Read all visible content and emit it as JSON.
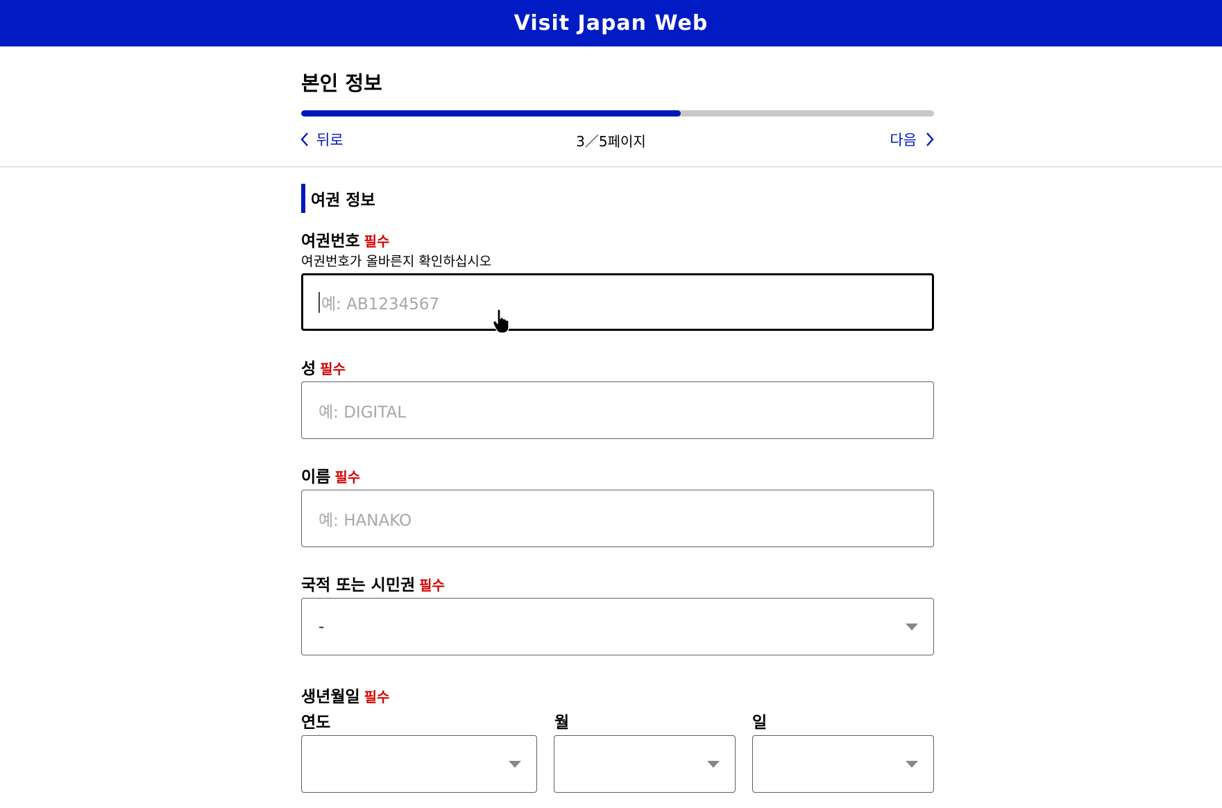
{
  "header": {
    "title": "Visit Japan Web"
  },
  "subheader": {
    "page_title": "본인 정보",
    "progress": {
      "current": 3,
      "total": 5,
      "fraction": 0.6
    },
    "back_label": "뒤로",
    "next_label": "다음",
    "page_indicator": "3／5페이지"
  },
  "form": {
    "section_title": "여권 정보",
    "required_tag": "필수",
    "passport": {
      "label": "여권번호",
      "helper": "여권번호가 올바른지 확인하십시오",
      "placeholder": "예: AB1234567",
      "value": ""
    },
    "surname": {
      "label": "성",
      "placeholder": "예: DIGITAL",
      "value": ""
    },
    "given_name": {
      "label": "이름",
      "placeholder": "예: HANAKO",
      "value": ""
    },
    "nationality": {
      "label": "국적 또는 시민권",
      "selected": "-"
    },
    "birthdate": {
      "label": "생년월일",
      "year_label": "연도",
      "year_selected": "",
      "month_label": "월",
      "month_selected": "",
      "day_label": "일",
      "day_selected": ""
    }
  },
  "colors": {
    "brand": "#001bc4",
    "accent": "#0019b8",
    "required": "#d40000"
  },
  "icons": [
    "chevron-left-icon",
    "chevron-right-icon",
    "dropdown-arrow-icon",
    "hand-cursor-icon"
  ]
}
